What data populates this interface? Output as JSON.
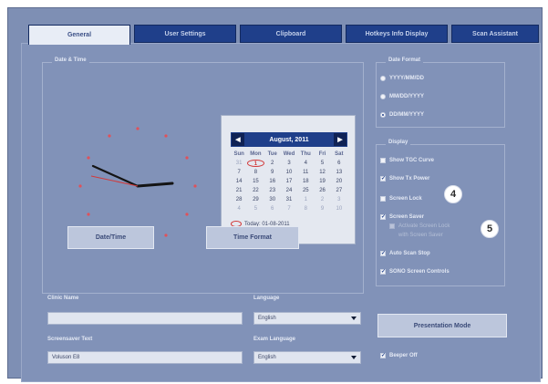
{
  "tabs": [
    {
      "label": "General",
      "active": true
    },
    {
      "label": "User Settings",
      "active": false
    },
    {
      "label": "Clipboard",
      "active": false
    },
    {
      "label": "Hotkeys Info Display",
      "active": false
    },
    {
      "label": "Scan Assistant",
      "active": false
    }
  ],
  "date_time": {
    "group_title": "Date & Time",
    "calendar": {
      "month_label": "August, 2011",
      "days_of_week": [
        "Sun",
        "Mon",
        "Tue",
        "Wed",
        "Thu",
        "Fri",
        "Sat"
      ],
      "weeks": [
        [
          "31",
          "1",
          "2",
          "3",
          "4",
          "5",
          "6"
        ],
        [
          "7",
          "8",
          "9",
          "10",
          "11",
          "12",
          "13"
        ],
        [
          "14",
          "15",
          "16",
          "17",
          "18",
          "19",
          "20"
        ],
        [
          "21",
          "22",
          "23",
          "24",
          "25",
          "26",
          "27"
        ],
        [
          "28",
          "29",
          "30",
          "31",
          "1",
          "2",
          "3"
        ],
        [
          "4",
          "5",
          "6",
          "7",
          "8",
          "9",
          "10"
        ]
      ],
      "today_text": "Today: 01-08-2011"
    },
    "date_time_button": "Date/Time",
    "time_format_button": "Time Format"
  },
  "date_format": {
    "group_title": "Date Format",
    "options": [
      {
        "label": "YYYY/MM/DD",
        "selected": false
      },
      {
        "label": "MM/DD/YYYY",
        "selected": false
      },
      {
        "label": "DD/MM/YYYY",
        "selected": true
      }
    ]
  },
  "display": {
    "group_title": "Display",
    "options": [
      {
        "label": "Show TGC Curve",
        "checked": false,
        "enabled": true
      },
      {
        "label": "Show Tx Power",
        "checked": true,
        "enabled": true
      },
      {
        "label": "Screen Lock",
        "checked": false,
        "enabled": true
      },
      {
        "label": "Screen Saver",
        "checked": true,
        "enabled": true
      },
      {
        "label": "Activate Screen Lock",
        "checked": false,
        "enabled": false
      },
      {
        "label": "with Screen Saver",
        "checked": false,
        "enabled": false
      },
      {
        "label": "Auto Scan Stop",
        "checked": true,
        "enabled": true
      },
      {
        "label": "SONO Screen Controls",
        "checked": true,
        "enabled": true
      }
    ]
  },
  "callouts": [
    "4",
    "5"
  ],
  "clinic_name": {
    "label": "Clinic Name",
    "value": ""
  },
  "language": {
    "label": "Language",
    "value": "English"
  },
  "screensaver_text": {
    "label": "Screensaver Text",
    "value": "Voluson E8"
  },
  "exam_language": {
    "label": "Exam Language",
    "value": "English"
  },
  "presentation_mode_button": "Presentation Mode",
  "beeper_off": {
    "label": "Beeper Off",
    "checked": true
  }
}
